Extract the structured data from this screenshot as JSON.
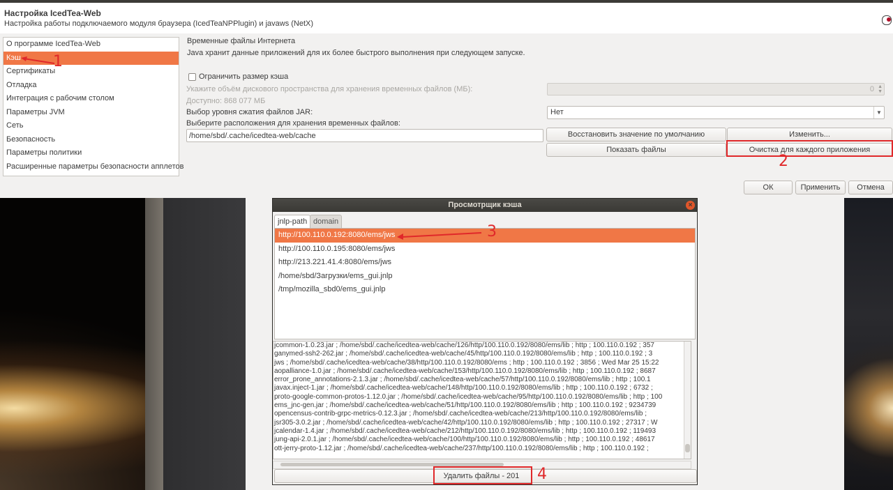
{
  "window": {
    "title": "Настройка IcedTea-Web",
    "subtitle": "Настройка работы подключаемого модуля браузера (IcedTeaNPPlugin) и javaws (NetX)"
  },
  "sidebar": {
    "items": [
      {
        "label": "О программе IcedTea-Web"
      },
      {
        "label": "Кэш"
      },
      {
        "label": "Сертификаты"
      },
      {
        "label": "Отладка"
      },
      {
        "label": "Интеграция с рабочим столом"
      },
      {
        "label": "Параметры JVM"
      },
      {
        "label": "Сеть"
      },
      {
        "label": "Безопасность"
      },
      {
        "label": "Параметры политики"
      },
      {
        "label": "Расширенные параметры безопасности апплетов"
      }
    ],
    "selected_index": 1
  },
  "cache_panel": {
    "group_title": "Временные файлы Интернета",
    "description": "Java хранит данные приложений для их более быстрого выполнения при следующем запуске.",
    "limit_checkbox_label": "Ограничить размер кэша",
    "disk_space_label": "Укажите объём дискового пространства для хранения временных файлов (МБ):",
    "disk_space_value": "0",
    "available_label": "Доступно: 868 077 МБ",
    "jar_compression_label": "Выбор уровня сжатия файлов JAR:",
    "jar_compression_value": "Нет",
    "location_label": "Выберите расположения для хранения временных файлов:",
    "location_value": "/home/sbd/.cache/icedtea-web/cache",
    "restore_default_button": "Восстановить значение по умолчанию",
    "change_button": "Изменить...",
    "show_files_button": "Показать файлы",
    "clear_per_app_button": "Очистка для каждого приложения"
  },
  "footer": {
    "ok_button": "ОК",
    "apply_button": "Применить",
    "cancel_button": "Отмена"
  },
  "cache_viewer": {
    "title": "Просмотрщик кэша",
    "tabs": [
      "jnlp-path",
      "domain"
    ],
    "urls": [
      "http://100.110.0.192:8080/ems/jws",
      "http://100.110.0.195:8080/ems/jws",
      "http://213.221.41.4:8080/ems/jws",
      "/home/sbd/Загрузки/ems_gui.jnlp",
      "/tmp/mozilla_sbd0/ems_gui.jnlp"
    ],
    "selected_url_index": 0,
    "detail_lines": [
      "jcommon-1.0.23.jar ; /home/sbd/.cache/icedtea-web/cache/126/http/100.110.0.192/8080/ems/lib ; http ; 100.110.0.192 ; 357",
      "ganymed-ssh2-262.jar ; /home/sbd/.cache/icedtea-web/cache/45/http/100.110.0.192/8080/ems/lib ; http ; 100.110.0.192 ; 3",
      "jws ; /home/sbd/.cache/icedtea-web/cache/38/http/100.110.0.192/8080/ems ; http ; 100.110.0.192 ; 3856 ; Wed Mar 25 15:22",
      "error_prone_annotations-2.1.3.jar ; /home/sbd/.cache/icedtea-web/cache/57/http/100.110.0.192/8080/ems/lib ; http ; 100.1",
      "javax.inject-1.jar ; /home/sbd/.cache/icedtea-web/cache/148/http/100.110.0.192/8080/ems/lib ; http ; 100.110.0.192 ; 6732 ;",
      "proto-google-common-protos-1.12.0.jar ; /home/sbd/.cache/icedtea-web/cache/95/http/100.110.0.192/8080/ems/lib ; http ; 100",
      "ems_jnc-gen.jar ; /home/sbd/.cache/icedtea-web/cache/51/http/100.110.0.192/8080/ems/lib ; http ; 100.110.0.192 ; 9234739",
      "opencensus-contrib-grpc-metrics-0.12.3.jar ; /home/sbd/.cache/icedtea-web/cache/213/http/100.110.0.192/8080/ems/lib ;",
      "jsr305-3.0.2.jar ; /home/sbd/.cache/icedtea-web/cache/42/http/100.110.0.192/8080/ems/lib ; http ; 100.110.0.192 ; 27317 ; W",
      "jcalendar-1.4.jar ; /home/sbd/.cache/icedtea-web/cache/212/http/100.110.0.192/8080/ems/lib ; http ; 100.110.0.192 ; 119493",
      "jung-api-2.0.1.jar ; /home/sbd/.cache/icedtea-web/cache/100/http/100.110.0.192/8080/ems/lib ; http ; 100.110.0.192 ; 48617",
      "ott-jerry-proto-1.12.jar ; /home/sbd/.cache/icedtea-web/cache/237/http/100.110.0.192/8080/ems/lib ; http ; 100.110.0.192 ;"
    ],
    "detail_overlap_line": "aopalliance-1.0.jar ; /home/sbd/.cache/icedtea-web/cache/153/http/100.110.0.192/8080/ems/lib ; http ; 100.110.0.192 ; 8687",
    "delete_button": "Удалить файлы - 201"
  },
  "annotations": [
    "1",
    "2",
    "3",
    "4"
  ],
  "colors": {
    "selection": "#f07746",
    "annotation": "#e0282a"
  }
}
